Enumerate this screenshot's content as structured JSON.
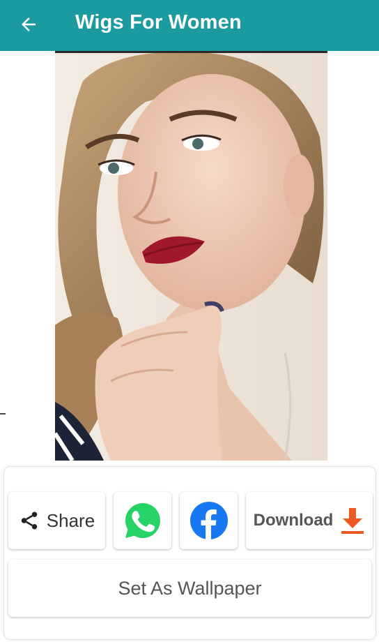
{
  "appbar": {
    "title": "Wigs For Women",
    "back_icon": "arrow-left-icon",
    "background": "#1b9aa0"
  },
  "image": {
    "subject": "woman with blonde hair in a loose braid, red lipstick, hand at chin"
  },
  "actions": {
    "share_label": "Share",
    "share_icon": "share-icon",
    "whatsapp_icon": "whatsapp-icon",
    "facebook_icon": "facebook-icon",
    "download_label": "Download",
    "download_icon": "download-icon",
    "wallpaper_label": "Set As Wallpaper"
  },
  "colors": {
    "whatsapp": "#25d366",
    "facebook": "#1877f2",
    "download": "#ee5a24"
  }
}
